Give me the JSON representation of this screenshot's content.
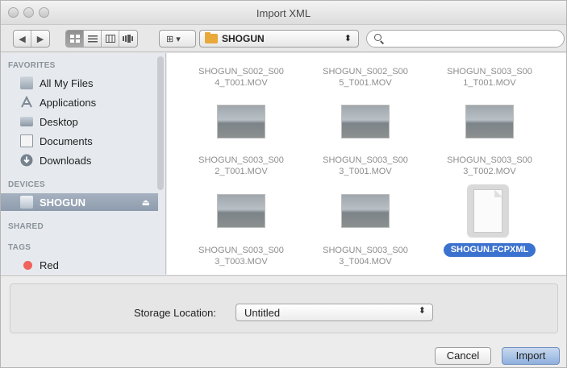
{
  "window": {
    "title": "Import XML"
  },
  "toolbar": {
    "nav_back": "◀",
    "nav_forward": "▶",
    "view_modes": [
      "icon-view",
      "list-view",
      "column-view",
      "cover-flow-view"
    ],
    "arrange_label": "⊞ ▾",
    "location": "SHOGUN",
    "location_arrows": "⬍",
    "search_placeholder": ""
  },
  "sidebar": {
    "favorites_header": "FAVORITES",
    "favorites": [
      {
        "label": "All My Files",
        "icon": "all-files-icon"
      },
      {
        "label": "Applications",
        "icon": "applications-icon"
      },
      {
        "label": "Desktop",
        "icon": "desktop-icon"
      },
      {
        "label": "Documents",
        "icon": "documents-icon"
      },
      {
        "label": "Downloads",
        "icon": "downloads-icon"
      }
    ],
    "devices_header": "DEVICES",
    "devices": [
      {
        "label": "SHOGUN",
        "icon": "drive-icon",
        "eject": "⏏"
      }
    ],
    "shared_header": "SHARED",
    "tags_header": "TAGS",
    "tags": [
      {
        "label": "Red",
        "color": "#f0625b"
      }
    ]
  },
  "files": [
    {
      "name_line1": "SHOGUN_S002_S00",
      "name_line2": "4_T001.MOV",
      "kind": "video"
    },
    {
      "name_line1": "SHOGUN_S002_S00",
      "name_line2": "5_T001.MOV",
      "kind": "video"
    },
    {
      "name_line1": "SHOGUN_S003_S00",
      "name_line2": "1_T001.MOV",
      "kind": "video"
    },
    {
      "name_line1": "SHOGUN_S003_S00",
      "name_line2": "2_T001.MOV",
      "kind": "video"
    },
    {
      "name_line1": "SHOGUN_S003_S00",
      "name_line2": "3_T001.MOV",
      "kind": "video"
    },
    {
      "name_line1": "SHOGUN_S003_S00",
      "name_line2": "3_T002.MOV",
      "kind": "video"
    },
    {
      "name_line1": "SHOGUN_S003_S00",
      "name_line2": "3_T003.MOV",
      "kind": "video"
    },
    {
      "name_line1": "SHOGUN_S003_S00",
      "name_line2": "3_T004.MOV",
      "kind": "video"
    },
    {
      "name_line1": "SHOGUN.FCPXML",
      "name_line2": "",
      "kind": "document",
      "selected": true
    }
  ],
  "footer": {
    "storage_label": "Storage Location:",
    "storage_value": "Untitled",
    "storage_arrows": "⬍",
    "cancel_label": "Cancel",
    "import_label": "Import"
  },
  "colors": {
    "selection": "#3c72cf",
    "sidebar_bg": "#e6eaee",
    "tag_red": "#f0625b"
  }
}
